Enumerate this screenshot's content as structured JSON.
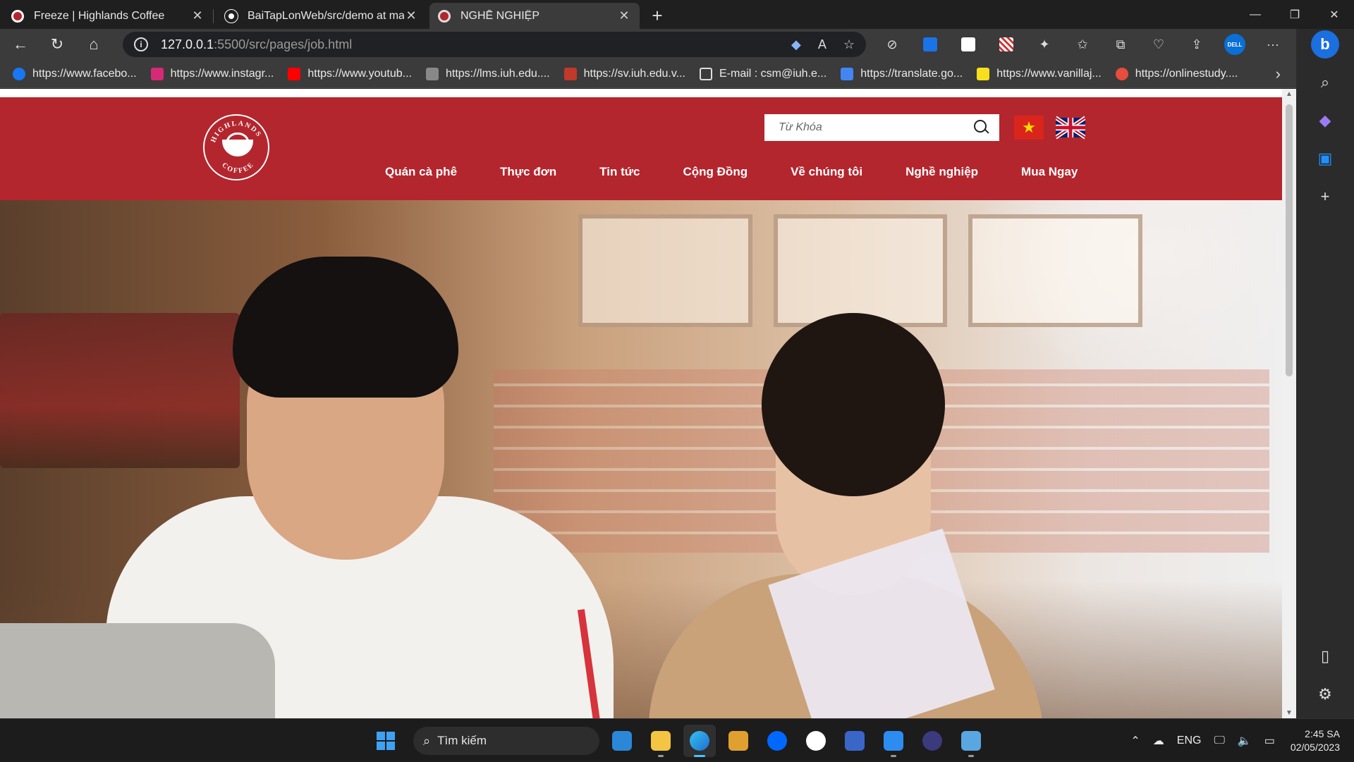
{
  "browser": {
    "tabs": [
      {
        "title": "Freeze | Highlands Coffee",
        "favicon_color": "#b3262e",
        "active": false
      },
      {
        "title": "BaiTapLonWeb/src/demo at main",
        "favicon_color": "#ffffff",
        "active": false
      },
      {
        "title": "NGHỀ NGHIỆP",
        "favicon_color": "#b3262e",
        "active": true
      }
    ],
    "url_host": "127.0.0.1",
    "url_path": ":5500/src/pages/job.html",
    "bookmarks": [
      {
        "label": "https://www.facebo...",
        "color": "#1877f2"
      },
      {
        "label": "https://www.instagr...",
        "color": "#d62976"
      },
      {
        "label": "https://www.youtub...",
        "color": "#ff0000"
      },
      {
        "label": "https://lms.iuh.edu....",
        "color": "#888888"
      },
      {
        "label": "https://sv.iuh.edu.v...",
        "color": "#c0392b"
      },
      {
        "label": "E-mail : csm@iuh.e...",
        "color": "#dddddd"
      },
      {
        "label": "https://translate.go...",
        "color": "#4285f4"
      },
      {
        "label": "https://www.vanillaj...",
        "color": "#f7df1e"
      },
      {
        "label": "https://onlinestudy....",
        "color": "#e74c3c"
      }
    ],
    "dell_label": "DELL"
  },
  "site": {
    "search_placeholder": "Từ Khóa",
    "logo_text": "HIGHLANDS COFFEE",
    "menu": [
      "Quán cà phê",
      "Thực đơn",
      "Tin tức",
      "Cộng Đồng",
      "Về chúng tôi",
      "Nghề nghiệp",
      "Mua Ngay"
    ],
    "header_color": "#b3262e"
  },
  "taskbar": {
    "search_label": "Tìm kiếm",
    "apps": [
      {
        "name": "store",
        "color": "#2b88d8"
      },
      {
        "name": "file-explorer",
        "color": "#f4c542"
      },
      {
        "name": "edge",
        "color": "#1e90c8"
      },
      {
        "name": "snipping",
        "color": "#e0a030"
      },
      {
        "name": "zalo",
        "color": "#0068ff"
      },
      {
        "name": "mongodb-compass",
        "color": "#ffffff"
      },
      {
        "name": "dev-cpp",
        "color": "#3a66c8"
      },
      {
        "name": "vscode",
        "color": "#2d8cf0"
      },
      {
        "name": "eclipse",
        "color": "#3b3a7c"
      },
      {
        "name": "task-manager",
        "color": "#5aa6e0"
      }
    ],
    "lang": "ENG",
    "time": "2:45 SA",
    "date": "02/05/2023"
  }
}
